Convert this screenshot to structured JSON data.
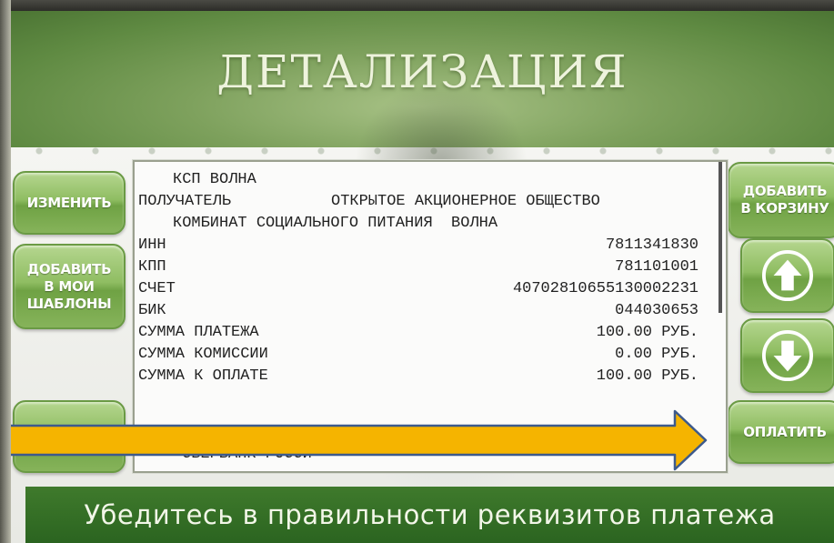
{
  "header": {
    "title": "ДЕТАЛИЗАЦИЯ"
  },
  "left_buttons": {
    "change": "ИЗМЕНИТЬ",
    "templates_l1": "ДОБАВИТЬ",
    "templates_l2": "В МОИ",
    "templates_l3": "ШАБЛОНЫ"
  },
  "right_buttons": {
    "cart_l1": "ДОБАВИТЬ",
    "cart_l2": "В КОРЗИНУ",
    "scroll_up_icon": "arrow-up-icon",
    "scroll_down_icon": "arrow-down-icon",
    "pay": "ОПЛАТИТЬ"
  },
  "details": {
    "provider": "КСП ВОЛНА",
    "recipient_label": "ПОЛУЧАТЕЛЬ",
    "recipient_value_1": "ОТКРЫТОЕ АКЦИОНЕРНОЕ ОБЩЕСТВО",
    "recipient_value_2": "КОМБИНАТ СОЦИАЛЬНОГО ПИТАНИЯ  ВОЛНА",
    "rows": [
      {
        "label": "ИНН",
        "value": "7811341830"
      },
      {
        "label": "КПП",
        "value": "781101001"
      },
      {
        "label": "СЧЕТ",
        "value": "40702810655130002231"
      },
      {
        "label": "БИК",
        "value": "044030653"
      },
      {
        "label": "СУММА ПЛАТЕЖА",
        "value": "100.00 РУБ."
      },
      {
        "label": "СУММА КОМИССИИ",
        "value": "0.00 РУБ."
      },
      {
        "label": "СУММА К ОПЛАТЕ",
        "value": "100.00 РУБ."
      }
    ],
    "bank_partial": "СБЕРБАНК РОССИ"
  },
  "footer": {
    "message": "Убедитесь в правильности реквизитов платежа"
  },
  "colors": {
    "button_green": "#86b35a",
    "footer_green": "#2b6420",
    "annotation_arrow": "#f5b400"
  }
}
